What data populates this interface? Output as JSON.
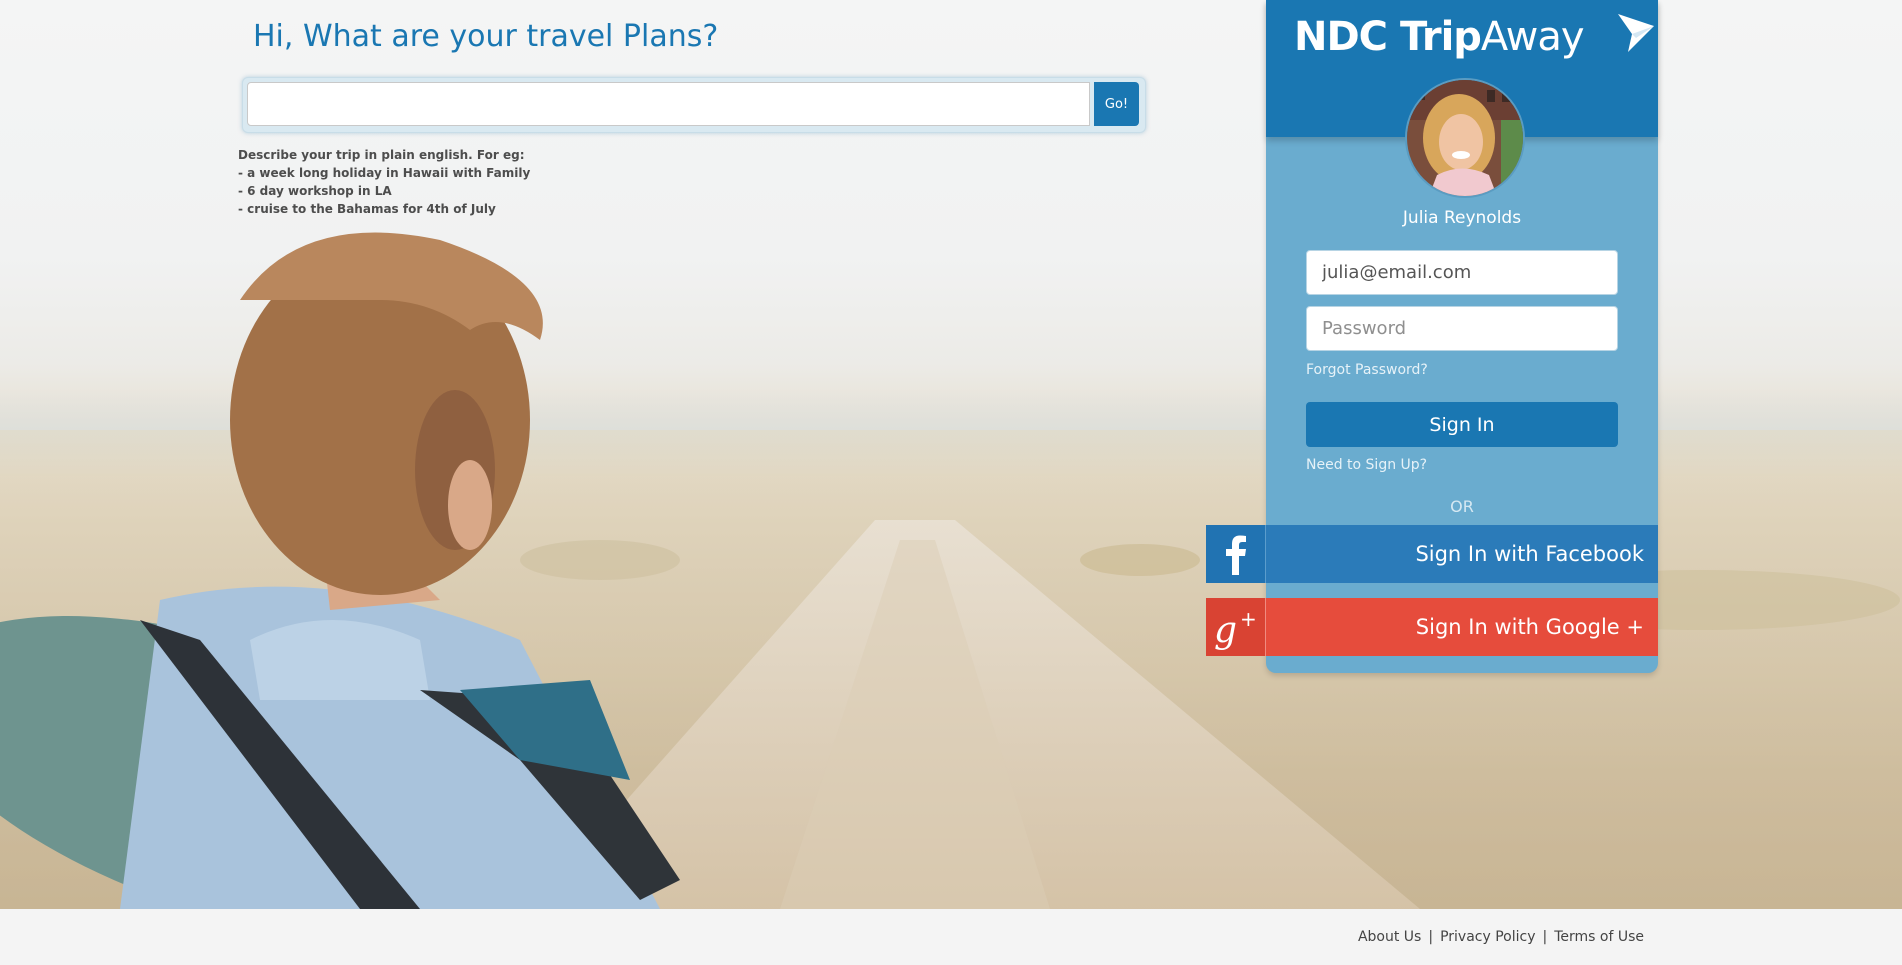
{
  "search": {
    "heading": "Hi, What are your travel Plans?",
    "input_value": "",
    "go_label": "Go!",
    "hint_lines": [
      "Describe your trip in plain english. For eg:",
      "- a week long holiday in Hawaii with Family",
      "- 6 day workshop in LA",
      "- cruise to the Bahamas for 4th of July"
    ]
  },
  "brand": {
    "name_bold": "NDC Trip",
    "name_light": "Away",
    "logo_icon": "paper-plane-icon",
    "color": "#1a77b2"
  },
  "login": {
    "user_name": "Julia Reynolds",
    "email_value": "julia@email.com",
    "password_placeholder": "Password",
    "forgot_label": "Forgot Password?",
    "signin_label": "Sign In",
    "signup_label": "Need to Sign Up?",
    "or_label": "OR",
    "facebook_label": "Sign In with Facebook",
    "facebook_icon": "facebook-icon",
    "google_label": "Sign In with Google +",
    "google_icon": "google-plus-icon",
    "facebook_color": "#2b7bb9",
    "google_color": "#e64c3c"
  },
  "footer": {
    "about_label": "About Us",
    "privacy_label": "Privacy Policy",
    "terms_label": "Terms of Use",
    "separator": "|"
  }
}
